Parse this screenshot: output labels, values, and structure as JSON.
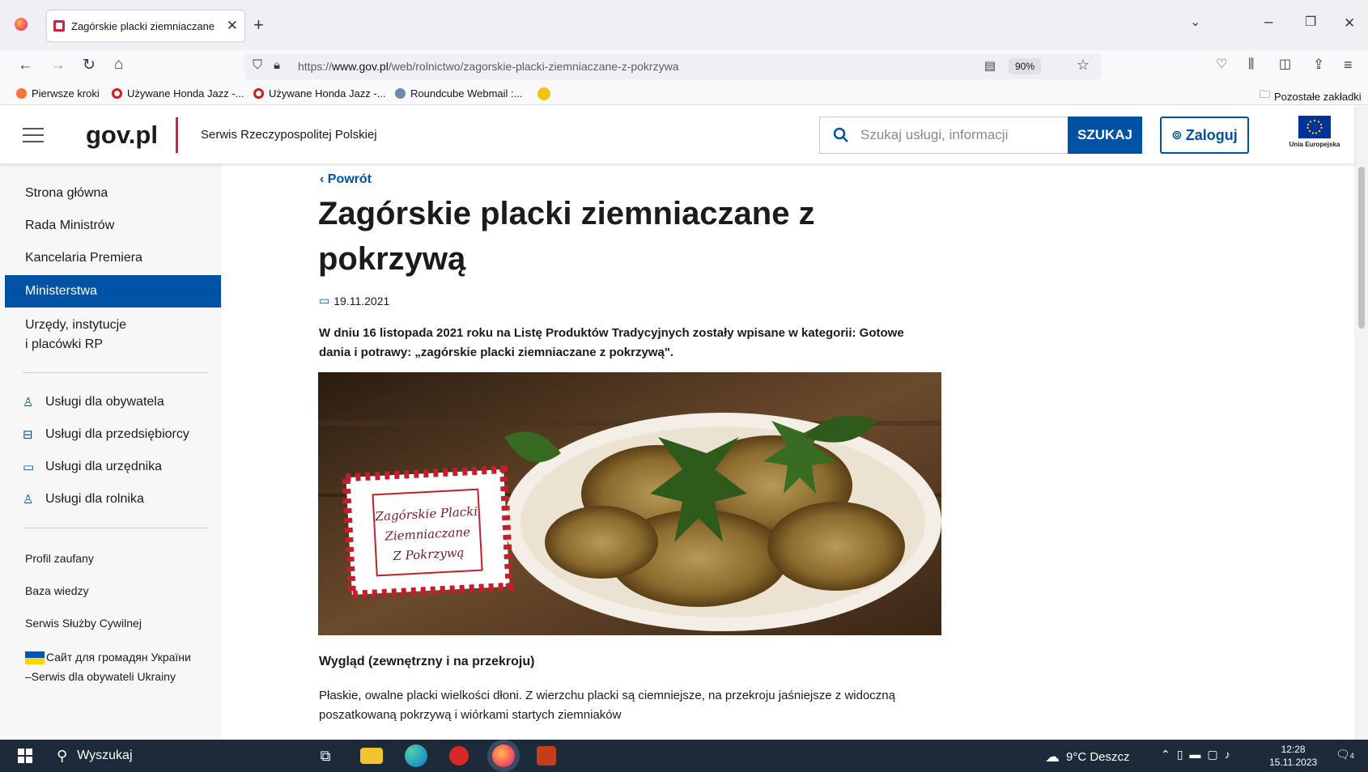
{
  "browser": {
    "tab_title": "Zagórskie placki ziemniaczane",
    "url_prefix": "https://",
    "url_domain": "www.gov.pl",
    "url_path": "/web/rolnictwo/zagorskie-placki-ziemniaczane-z-pokrzywa",
    "zoom": "90%",
    "bookmarks": [
      "Pierwsze kroki",
      "Używane Honda Jazz -...",
      "Używane Honda Jazz -...",
      "Roundcube Webmail :..."
    ],
    "other_bookmarks": "Pozostałe zakładki"
  },
  "header": {
    "logo": "gov.pl",
    "service_name": "Serwis Rzeczypospolitej Polskiej",
    "search_placeholder": "Szukaj usługi, informacji",
    "search_button": "SZUKAJ",
    "login_button": "Zaloguj",
    "eu_label": "Unia Europejska"
  },
  "sidebar": {
    "items": [
      "Strona główna",
      "Rada Ministrów",
      "Kancelaria Premiera",
      "Ministerstwa",
      "Urzędy, instytucje",
      "i placówki RP"
    ],
    "active": "Ministerstwa",
    "services": [
      "Usługi dla obywatela",
      "Usługi dla przedsiębiorcy",
      "Usługi dla urzędnika",
      "Usługi dla rolnika"
    ],
    "links": [
      "Profil zaufany",
      "Baza wiedzy",
      "Serwis Służby Cywilnej"
    ],
    "ukraine_line1": "Сайт для громадян України",
    "ukraine_line2": "–Serwis dla obywateli Ukrainy"
  },
  "article": {
    "back": "Powrót",
    "title": "Zagórskie placki ziemniaczane z pokrzywą",
    "date": "19.11.2021",
    "lead": "W dniu 16 listopada 2021 roku na Listę Produktów Tradycyjnych zostały wpisane w kategorii: Gotowe dania i potrawy: „zagórskie placki ziemniaczane z pokrzywą\".",
    "photo_card_line1": "Zagórskie Placki",
    "photo_card_line2": "Ziemniaczane",
    "photo_card_line3": "Z Pokrzywą",
    "section_heading": "Wygląd (zewnętrzny i na przekroju)",
    "section_text": "Płaskie, owalne placki wielkości dłoni. Z wierzchu placki są ciemniejsze, na przekroju jaśniejsze z widoczną poszatkowaną pokrzywą i wiórkami startych ziemniaków"
  },
  "taskbar": {
    "search": "Wyszukaj",
    "weather": "9°C Deszcz",
    "time": "12:28",
    "date": "15.11.2023",
    "notifications": "4"
  },
  "colors": {
    "brand_blue": "#0052a5",
    "brand_red": "#d4213d"
  }
}
